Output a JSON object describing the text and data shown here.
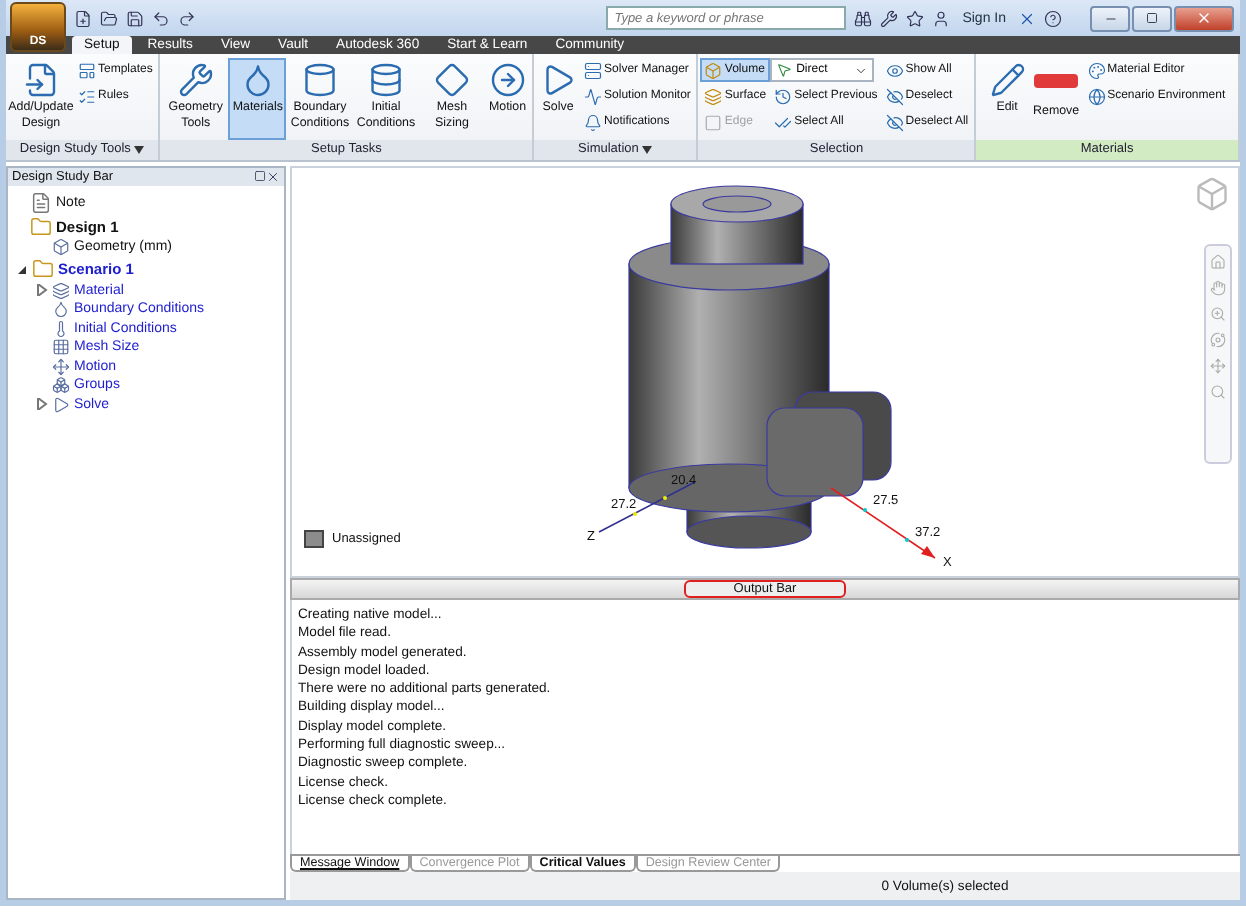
{
  "window": {
    "app_button": "DS",
    "search": {
      "placeholder": "Type a keyword or phrase"
    },
    "sign_in": "Sign In"
  },
  "ribbon_tabs": [
    {
      "label": "Setup",
      "selected": true
    },
    {
      "label": "Results",
      "selected": false
    },
    {
      "label": "View",
      "selected": false
    },
    {
      "label": "Vault",
      "selected": false
    },
    {
      "label": "Autodesk 360",
      "selected": false
    },
    {
      "label": "Start & Learn",
      "selected": false
    },
    {
      "label": "Community",
      "selected": false
    }
  ],
  "ribbon_groups": [
    {
      "label": "Design Study Tools",
      "menu": true,
      "contextual": false,
      "columns": [
        [
          {
            "kind": "large",
            "label": "Add/Update Design"
          }
        ],
        [
          {
            "kind": "small",
            "label": "Templates"
          },
          {
            "kind": "small",
            "label": "Rules"
          }
        ]
      ]
    },
    {
      "label": "Setup Tasks",
      "menu": false,
      "contextual": false,
      "columns": [
        [
          {
            "kind": "large",
            "label": "Geometry Tools",
            "selected": false
          }
        ],
        [
          {
            "kind": "large",
            "label": "Materials",
            "selected": true
          }
        ],
        [
          {
            "kind": "large",
            "label": "Boundary Conditions",
            "selected": false
          }
        ],
        [
          {
            "kind": "large",
            "label": "Initial Conditions",
            "selected": false
          }
        ],
        [
          {
            "kind": "large",
            "label": "Mesh Sizing",
            "selected": false
          }
        ],
        [
          {
            "kind": "large",
            "label": "Motion",
            "selected": false
          }
        ]
      ]
    },
    {
      "label": "Simulation",
      "menu": true,
      "contextual": false,
      "columns": [
        [
          {
            "kind": "large",
            "label": "Solve"
          }
        ],
        [
          {
            "kind": "small",
            "label": "Solver Manager"
          },
          {
            "kind": "small",
            "label": "Solution Monitor"
          },
          {
            "kind": "small",
            "label": "Notifications"
          }
        ]
      ]
    },
    {
      "label": "Selection",
      "menu": false,
      "contextual": false,
      "columns": [
        [
          {
            "kind": "toggle",
            "label": "Volume",
            "selected": true,
            "disabled": false
          },
          {
            "kind": "toggle",
            "label": "Surface",
            "selected": false,
            "disabled": false
          },
          {
            "kind": "toggle",
            "label": "Edge",
            "selected": false,
            "disabled": true
          }
        ],
        [
          {
            "kind": "dropdown",
            "label": "Direct"
          },
          {
            "kind": "small",
            "label": "Select Previous"
          },
          {
            "kind": "small",
            "label": "Select All"
          }
        ],
        [
          {
            "kind": "small",
            "label": "Show All"
          },
          {
            "kind": "small",
            "label": "Deselect"
          },
          {
            "kind": "small",
            "label": "Deselect All"
          }
        ]
      ]
    },
    {
      "label": "Materials",
      "menu": false,
      "contextual": true,
      "columns": [
        [
          {
            "kind": "large",
            "label": "Edit"
          }
        ],
        [
          {
            "kind": "large",
            "label": "Remove"
          }
        ],
        [
          {
            "kind": "small",
            "label": "Material Editor"
          },
          {
            "kind": "small",
            "label": "Scenario Environment"
          }
        ]
      ]
    }
  ],
  "design_study_bar": {
    "title": "Design Study Bar",
    "tree": [
      {
        "label": "Note"
      },
      {
        "label": "Design 1",
        "children": [
          {
            "label": "Geometry (mm)"
          }
        ]
      },
      {
        "label": "Scenario 1",
        "expanded": true,
        "children": [
          {
            "label": "Material",
            "expanded": false
          },
          {
            "label": "Boundary Conditions"
          },
          {
            "label": "Initial Conditions"
          },
          {
            "label": "Mesh Size"
          },
          {
            "label": "Motion"
          },
          {
            "label": "Groups"
          },
          {
            "label": "Solve",
            "expanded": false
          }
        ]
      }
    ]
  },
  "viewport": {
    "axis_labels": [
      "Z",
      "27.2",
      "20.4",
      "27.5",
      "37.2",
      "X"
    ],
    "legend": {
      "label": "Unassigned",
      "color": "#8c8c8c"
    }
  },
  "output_bar": {
    "title": "Output Bar",
    "messages": [
      "Creating native model...",
      "Model file read.",
      "Assembly model generated.",
      "Design model loaded.",
      "There were no additional parts generated.",
      "Building display model...",
      "Display model complete.",
      "Performing full diagnostic sweep...",
      "Diagnostic sweep complete.",
      "License check.",
      "License check complete."
    ],
    "tabs": [
      {
        "label": "Message Window",
        "selected": true,
        "enabled": true
      },
      {
        "label": "Convergence Plot",
        "selected": false,
        "enabled": false
      },
      {
        "label": "Critical Values",
        "selected": false,
        "enabled": true
      },
      {
        "label": "Design Review Center",
        "selected": false,
        "enabled": false
      }
    ]
  },
  "status_bar": {
    "text": "0 Volume(s) selected"
  }
}
